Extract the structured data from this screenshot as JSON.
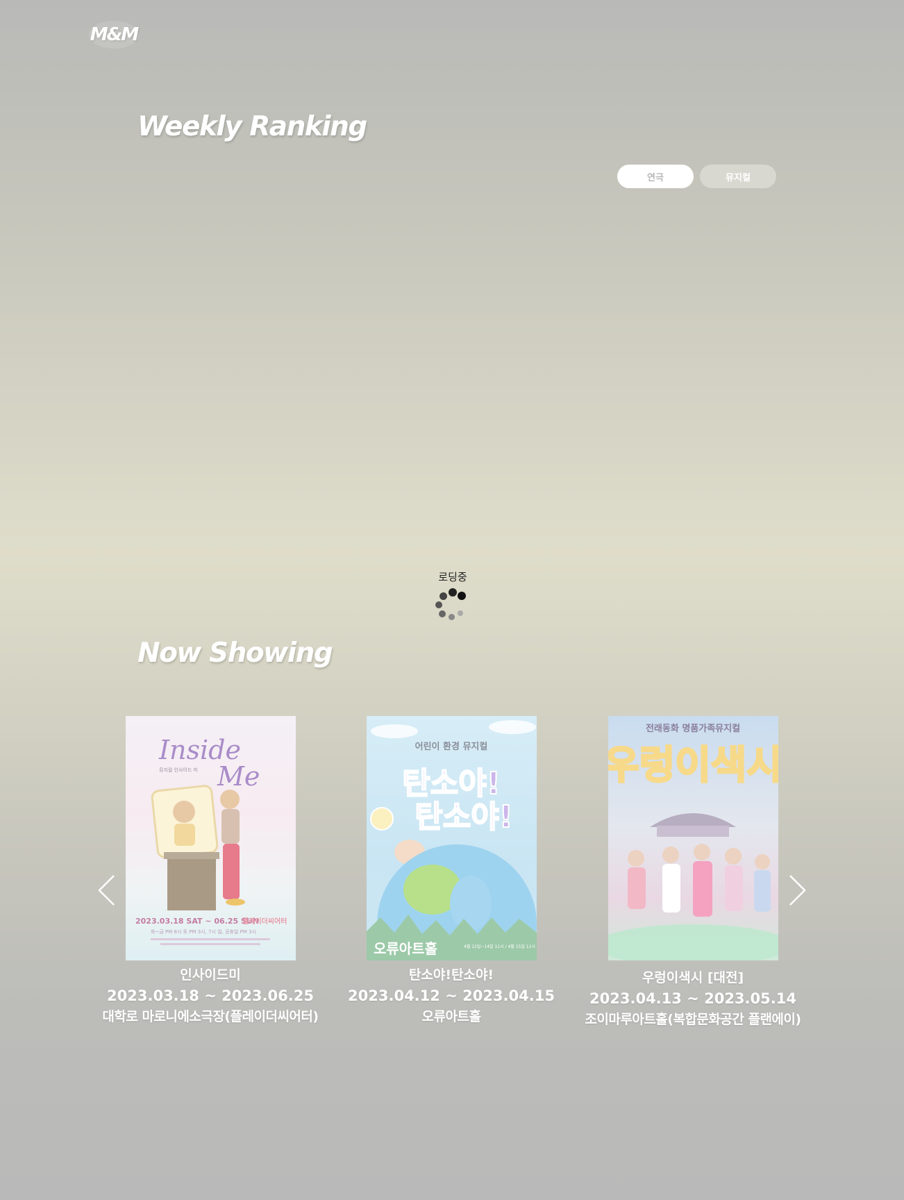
{
  "header": {
    "logo_text": "M&M"
  },
  "weekly_ranking": {
    "title": "Weekly Ranking",
    "tabs": [
      {
        "label": "연극",
        "active": true
      },
      {
        "label": "뮤지컬",
        "active": false
      }
    ]
  },
  "loading": {
    "text": "로딩중"
  },
  "now_showing": {
    "title": "Now Showing",
    "cards": [
      {
        "name": "인사이드미",
        "date": "2023.03.18 ~ 2023.06.25",
        "venue": "대학로 마로니에소극장(플레이더씨어터)",
        "poster": {
          "title_en_1": "Inside",
          "title_en_2": "Me",
          "subtitle": "뮤지컬 인사이드 미",
          "dates": "2023.03.18 SAT ~ 06.25 SUN",
          "theater": "플레이더씨어터",
          "times": "화~금 PM 8시   토 PM 3시, 7시   일, 공휴일 PM 3시"
        }
      },
      {
        "name": "탄소야!탄소야!",
        "date": "2023.04.12 ~ 2023.04.15",
        "venue": "오류아트홀",
        "poster": {
          "top": "어린이 환경 뮤지컬",
          "title_1": "탄소야!",
          "title_2": "탄소야!",
          "hall": "오류아트홀",
          "sched": "4월 12일~14일 11시 / 4월 15일 11시 14시 16시"
        }
      },
      {
        "name": "우렁이색시 [대전]",
        "date": "2023.04.13 ~ 2023.05.14",
        "venue": "조이마루아트홀(복합문화공간 플랜에이)",
        "poster": {
          "top": "전래동화 명품가족뮤지컬",
          "title": "우렁이색시"
        }
      }
    ]
  },
  "icons": {
    "prev": "chevron-left-icon",
    "next": "chevron-right-icon"
  }
}
